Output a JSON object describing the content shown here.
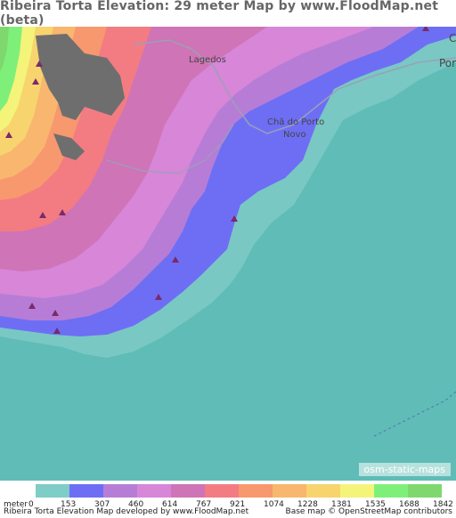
{
  "title": "Ribeira Torta Elevation: 29 meter Map by www.FloodMap.net (beta)",
  "map": {
    "places": [
      {
        "name": "Lagedos"
      },
      {
        "name": "Chã do Porto"
      },
      {
        "name": "Novo"
      },
      {
        "name": "Por"
      },
      {
        "name": "C"
      }
    ],
    "attribution_box": "osm-static-maps"
  },
  "legend": {
    "unit_label": "meter",
    "values": [
      "0",
      "153",
      "307",
      "460",
      "614",
      "767",
      "921",
      "1074",
      "1228",
      "1381",
      "1535",
      "1688",
      "1842"
    ],
    "colors": [
      "#7ecdc7",
      "#6e6ef5",
      "#b77dd6",
      "#d786d8",
      "#cf74b6",
      "#f37c82",
      "#f7986e",
      "#f8b66e",
      "#f7d46e",
      "#f4f47a",
      "#7ef07a",
      "#7ed86e"
    ]
  },
  "footer": {
    "left": "Ribeira Torta Elevation Map developed by www.FloodMap.net",
    "right": "Base map © OpenStreetMap contributors"
  },
  "colors": {
    "sea": "#5fbcb7",
    "coastal_lowland": "#79c8c4",
    "lowland_blue": "#6e6ef5",
    "urban_gray": "#6e6e6e"
  }
}
